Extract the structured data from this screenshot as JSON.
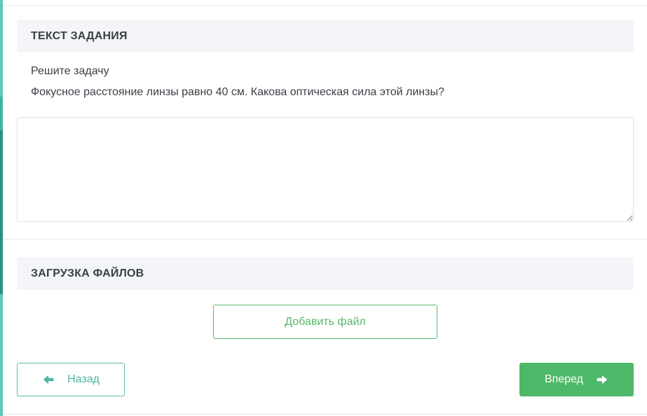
{
  "task_section": {
    "header": "ТЕКСТ ЗАДАНИЯ",
    "line1": "Решите задачу",
    "line2": "Фокусное расстояние линзы равно 40 см. Какова оптическая сила этой линзы?",
    "answer_value": ""
  },
  "files_section": {
    "header": "ЗАГРУЗКА ФАЙЛОВ",
    "add_file_label": "Добавить файл"
  },
  "navigation": {
    "back_label": "Назад",
    "back_icon": "arrow-left-icon",
    "next_label": "Вперед",
    "next_icon": "arrow-right-icon"
  },
  "colors": {
    "accent_green": "#4db868",
    "accent_teal": "#5ccab7",
    "header_bg": "#f4f5f8"
  }
}
